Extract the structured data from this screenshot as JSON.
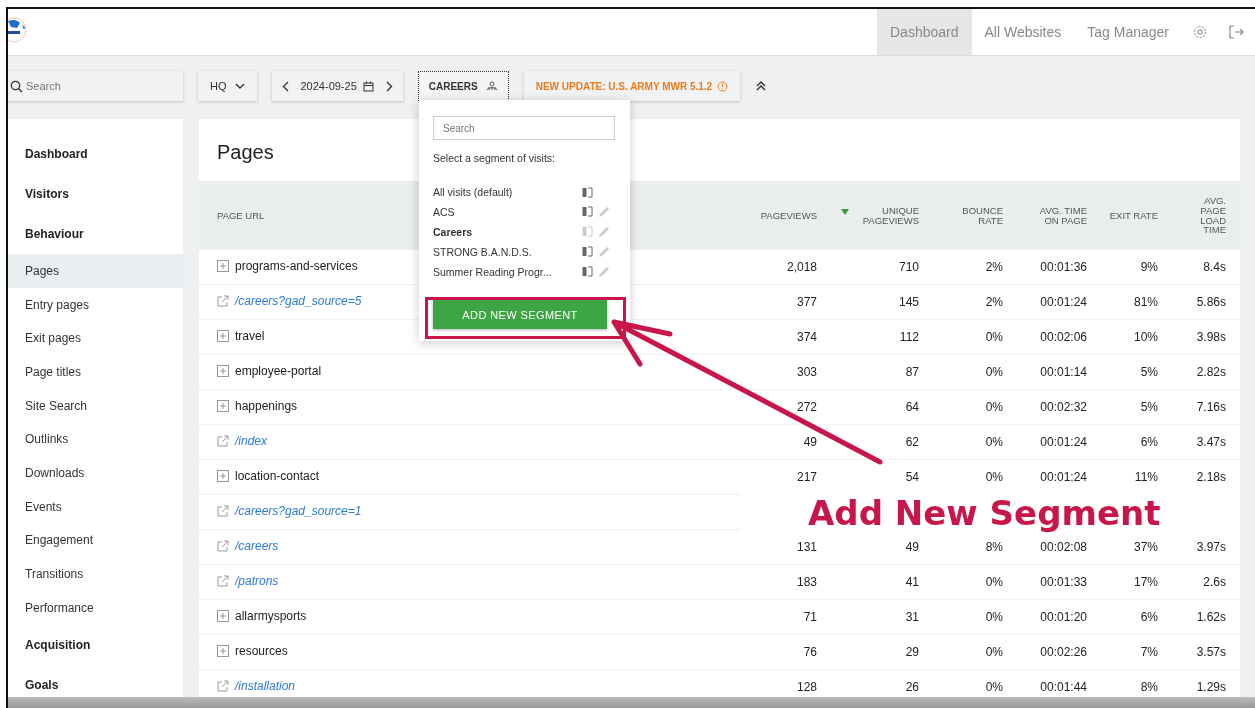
{
  "header": {
    "nav": [
      {
        "label": "Dashboard",
        "selected": true
      },
      {
        "label": "All Websites",
        "selected": false
      },
      {
        "label": "Tag Manager",
        "selected": false
      }
    ]
  },
  "toolbar": {
    "search": {
      "placeholder": "Search"
    },
    "site": "HQ",
    "date": "2024-09-25",
    "segment": "CAREERS",
    "notice": "NEW UPDATE: U.S. ARMY MWR 5.1.2"
  },
  "segment_menu": {
    "search": {
      "placeholder": "Search"
    },
    "prompt": "Select a segment of visits:",
    "segments": [
      {
        "name": "All visits (default)",
        "selected": false,
        "editable": false
      },
      {
        "name": "ACS",
        "selected": false,
        "editable": true
      },
      {
        "name": "Careers",
        "selected": true,
        "editable": true
      },
      {
        "name": "STRONG B.A.N.D.S.",
        "selected": false,
        "editable": true
      },
      {
        "name": "Summer Reading Progr...",
        "selected": false,
        "editable": true
      }
    ],
    "add_button": "ADD NEW SEGMENT"
  },
  "sidebar": {
    "items": [
      {
        "label": "Dashboard",
        "kind": "category",
        "selected": false
      },
      {
        "label": "Visitors",
        "kind": "category",
        "selected": false
      },
      {
        "label": "Behaviour",
        "kind": "category",
        "selected": false
      },
      {
        "label": "Pages",
        "kind": "page",
        "selected": true
      },
      {
        "label": "Entry pages",
        "kind": "page",
        "selected": false
      },
      {
        "label": "Exit pages",
        "kind": "page",
        "selected": false
      },
      {
        "label": "Page titles",
        "kind": "page",
        "selected": false
      },
      {
        "label": "Site Search",
        "kind": "page",
        "selected": false
      },
      {
        "label": "Outlinks",
        "kind": "page",
        "selected": false
      },
      {
        "label": "Downloads",
        "kind": "page",
        "selected": false
      },
      {
        "label": "Events",
        "kind": "page",
        "selected": false
      },
      {
        "label": "Engagement",
        "kind": "page",
        "selected": false
      },
      {
        "label": "Transitions",
        "kind": "page",
        "selected": false
      },
      {
        "label": "Performance",
        "kind": "page",
        "selected": false
      },
      {
        "label": "Acquisition",
        "kind": "category",
        "selected": false
      },
      {
        "label": "Goals",
        "kind": "category",
        "selected": false
      }
    ]
  },
  "report": {
    "title": "Pages",
    "columns": [
      {
        "label": "PAGE URL",
        "sorted": false
      },
      {
        "label": "PAGEVIEWS",
        "sorted": false
      },
      {
        "label": "UNIQUE PAGEVIEWS",
        "sorted": true
      },
      {
        "label": "BOUNCE RATE",
        "sorted": false
      },
      {
        "label": "AVG. TIME ON PAGE",
        "sorted": false
      },
      {
        "label": "EXIT RATE",
        "sorted": false
      },
      {
        "label": "AVG. PAGE LOAD TIME",
        "sorted": false
      }
    ],
    "rows": [
      {
        "kind": "folder",
        "cells": [
          "programs-and-services",
          "2,018",
          "710",
          "2%",
          "00:01:36",
          "9%",
          "8.4s"
        ]
      },
      {
        "kind": "link",
        "cells": [
          "/careers?gad_source=5",
          "377",
          "145",
          "2%",
          "00:01:24",
          "81%",
          "5.86s"
        ]
      },
      {
        "kind": "folder",
        "cells": [
          "travel",
          "374",
          "112",
          "0%",
          "00:02:06",
          "10%",
          "3.98s"
        ]
      },
      {
        "kind": "folder",
        "cells": [
          "employee-portal",
          "303",
          "87",
          "0%",
          "00:01:14",
          "5%",
          "2.82s"
        ]
      },
      {
        "kind": "folder",
        "cells": [
          "happenings",
          "272",
          "64",
          "0%",
          "00:02:32",
          "5%",
          "7.16s"
        ]
      },
      {
        "kind": "link",
        "cells": [
          "/index",
          "49",
          "62",
          "0%",
          "00:01:24",
          "6%",
          "3.47s"
        ]
      },
      {
        "kind": "folder",
        "cells": [
          "location-contact",
          "217",
          "54",
          "0%",
          "00:01:24",
          "11%",
          "2.18s"
        ]
      },
      {
        "kind": "link",
        "cells": [
          "/careers?gad_source=1"
        ]
      },
      {
        "kind": "link",
        "cells": [
          "/careers",
          "131",
          "49",
          "8%",
          "00:02:08",
          "37%",
          "3.97s"
        ]
      },
      {
        "kind": "link",
        "cells": [
          "/patrons",
          "183",
          "41",
          "0%",
          "00:01:33",
          "17%",
          "2.6s"
        ]
      },
      {
        "kind": "folder",
        "cells": [
          "allarmysports",
          "71",
          "31",
          "0%",
          "00:01:20",
          "6%",
          "1.62s"
        ]
      },
      {
        "kind": "folder",
        "cells": [
          "resources",
          "76",
          "29",
          "0%",
          "00:02:26",
          "7%",
          "3.57s"
        ]
      },
      {
        "kind": "link",
        "cells": [
          "/installation",
          "128",
          "26",
          "0%",
          "00:01:44",
          "8%",
          "1.29s"
        ]
      }
    ]
  },
  "annotation": {
    "text": "Add New Segment"
  }
}
